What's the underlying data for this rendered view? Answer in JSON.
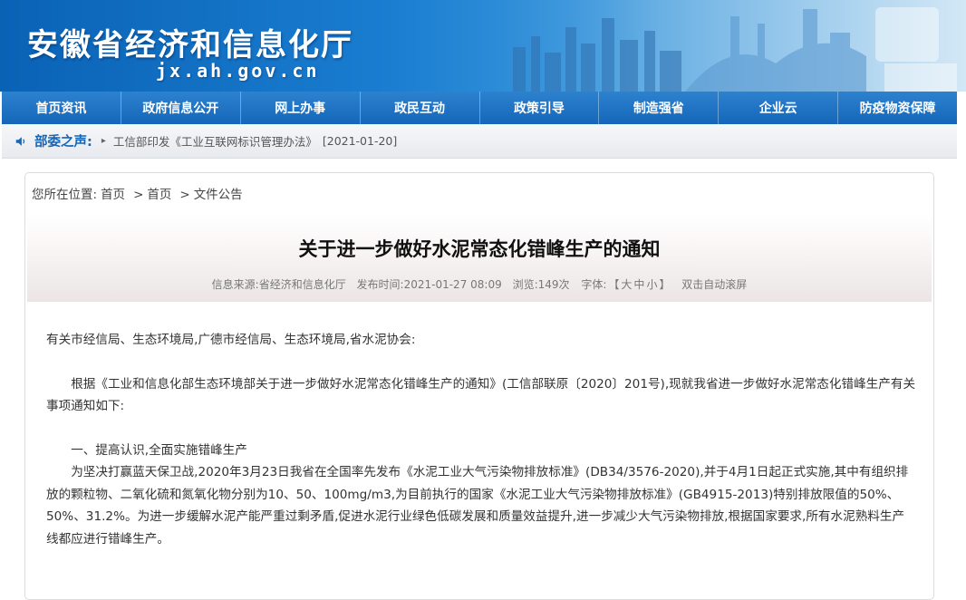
{
  "header": {
    "title": "安徽省经济和信息化厅",
    "url": "jx.ah.gov.cn"
  },
  "nav": {
    "items": [
      "首页资讯",
      "政府信息公开",
      "网上办事",
      "政民互动",
      "政策引导",
      "制造强省",
      "企业云",
      "防疫物资保障"
    ]
  },
  "notice": {
    "icon": "speaker-icon",
    "label": "部委之声:",
    "arrow": "▸",
    "text": "工信部印发《工业互联网标识管理办法》",
    "date": "[2021-01-20]"
  },
  "breadcrumb": {
    "prefix": "您所在位置:",
    "items": [
      "首页",
      "首页",
      "文件公告"
    ],
    "separator": ">"
  },
  "article": {
    "title": "关于进一步做好水泥常态化错峰生产的通知",
    "meta": {
      "source": "信息来源:省经济和信息化厅",
      "time": "发布时间:2021-01-27 08:09",
      "views": "浏览:149次",
      "font_label": "字体:",
      "font_open": "【",
      "font_large": "大",
      "font_medium": "中",
      "font_small": "小",
      "font_close": "】",
      "auto_scroll": "双击自动滚屏"
    },
    "paragraphs": {
      "salutation": "有关市经信局、生态环境局,广德市经信局、生态环境局,省水泥协会:",
      "p1": "根据《工业和信息化部生态环境部关于进一步做好水泥常态化错峰生产的通知》(工信部联原〔2020〕201号),现就我省进一步做好水泥常态化错峰生产有关事项通知如下:",
      "h1": "一、提高认识,全面实施错峰生产",
      "p2": "为坚决打赢蓝天保卫战,2020年3月23日我省在全国率先发布《水泥工业大气污染物排放标准》(DB34/3576-2020),并于4月1日起正式实施,其中有组织排放的颗粒物、二氧化硫和氮氧化物分别为10、50、100mg/m3,为目前执行的国家《水泥工业大气污染物排放标准》(GB4915-2013)特别排放限值的50%、50%、31.2%。为进一步缓解水泥产能严重过剩矛盾,促进水泥行业绿色低碳发展和质量效益提升,进一步减少大气污染物排放,根据国家要求,所有水泥熟料生产线都应进行错峰生产。"
    }
  },
  "colors": {
    "nav_bg": "#1566b8",
    "notice_label": "#1565b8",
    "banner_dark": "#0a62b5"
  }
}
